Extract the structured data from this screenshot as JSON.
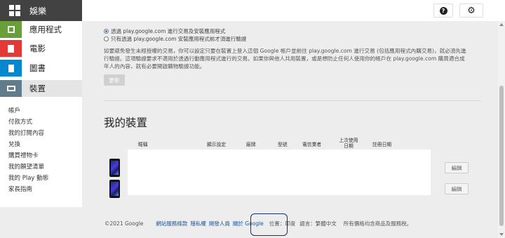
{
  "header": {
    "title": "娛樂",
    "brand_color": "#424242",
    "help_icon": "help-circle-icon",
    "settings_icon": "gear-icon"
  },
  "sidebar": {
    "categories": [
      {
        "label": "應用程式",
        "color": "#689f38",
        "icon": "apps-icon"
      },
      {
        "label": "電影",
        "color": "#e53935",
        "icon": "movies-icon"
      },
      {
        "label": "圖書",
        "color": "#0288d1",
        "icon": "books-icon"
      },
      {
        "label": "裝置",
        "color": "#607d8b",
        "icon": "devices-icon"
      }
    ],
    "account_links": [
      "帳戶",
      "付款方式",
      "我的訂閱內容",
      "兌換",
      "購買禮物卡",
      "我的願望清單",
      "我的 Play 動態",
      "家長指南"
    ]
  },
  "settings": {
    "option_1": "透過 play.google.com 進行交易及安裝應用程式",
    "option_2": "只有透過 play.google.com 安裝應用程式前才須進行驗證",
    "paragraph": "如要避免發生未經授權的交易，你可以設定只要在裝置上登入這個 Google 帳戶並前往 play.google.com 進行交易 (包括應用程式內購交易)，就必須先進行驗證。這項驗證要求不適用於透過行動應用程式進行的交易。如果你與他人共用裝置，或是想防止任何人使用你的帳戶在 play.google.com 購買適合成年人的內容，就有必要開啟購物驗證功能。",
    "update_button": "更新"
  },
  "devices": {
    "title": "我的裝置",
    "columns": [
      "暱稱",
      "顯示設定",
      "廠牌",
      "型號",
      "電信業者",
      "上次使用日期",
      "註冊日期"
    ],
    "edit_label": "編輯"
  },
  "footer": {
    "copyright": "©2021 Google",
    "links": [
      "網站服務條款",
      "隱私權",
      "開發人員",
      "關於 Google"
    ],
    "location": "位置：印度",
    "language": "語言：繁體中文",
    "tax_note": "所有價格均含商品及服務稅。"
  }
}
